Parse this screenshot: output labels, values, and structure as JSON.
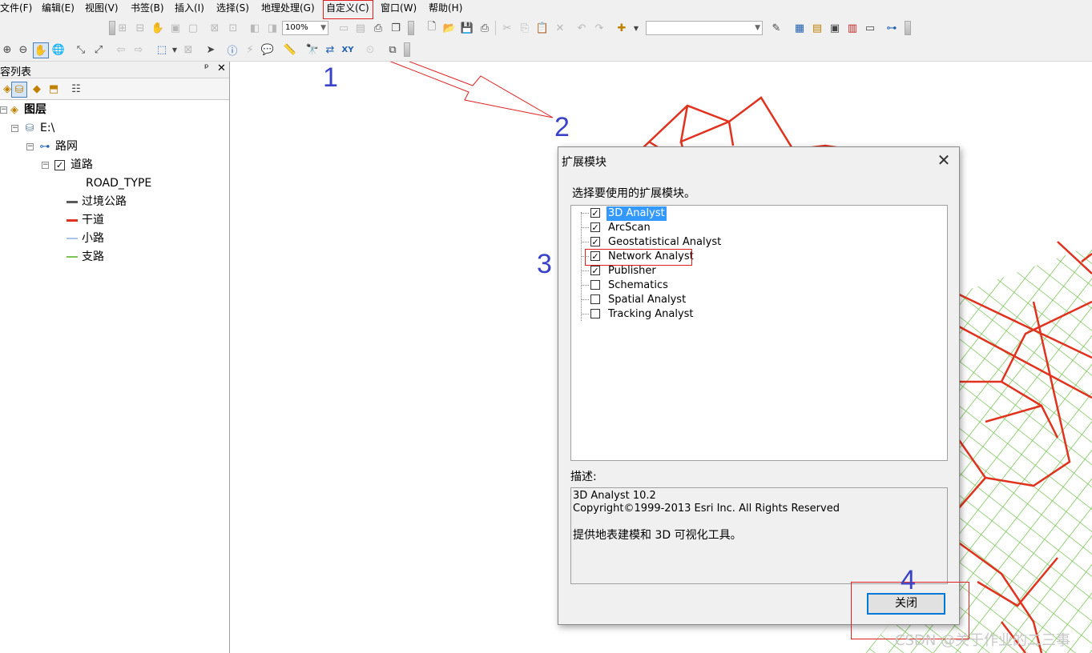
{
  "menu": [
    "文件(F)",
    "编辑(E)",
    "视图(V)",
    "书签(B)",
    "插入(I)",
    "选择(S)",
    "地理处理(G)",
    "自定义(C)",
    "窗口(W)",
    "帮助(H)"
  ],
  "toolbar": {
    "zoom_value": "100%",
    "scale_value": ""
  },
  "toc": {
    "title": "容列表",
    "pin_glyph": "ᵖ",
    "close_glyph": "✕",
    "root_label": "图层",
    "workspace_label": "E:\\",
    "dataset_label": "路网",
    "layer_label": "道路",
    "field_label": "ROAD_TYPE",
    "legend": [
      {
        "label": "过境公路",
        "color": "#5a5a5a"
      },
      {
        "label": "干道",
        "color": "#e0321e"
      },
      {
        "label": "小路",
        "color": "#a8c4e8"
      },
      {
        "label": "支路",
        "color": "#7cc45a"
      }
    ]
  },
  "dialog": {
    "title": "扩展模块",
    "prompt": "选择要使用的扩展模块。",
    "extensions": [
      {
        "name": "3D Analyst",
        "checked": true,
        "selected": true
      },
      {
        "name": "ArcScan",
        "checked": true,
        "selected": false
      },
      {
        "name": "Geostatistical Analyst",
        "checked": true,
        "selected": false
      },
      {
        "name": "Network Analyst",
        "checked": true,
        "selected": false
      },
      {
        "name": "Publisher",
        "checked": true,
        "selected": false
      },
      {
        "name": "Schematics",
        "checked": false,
        "selected": false
      },
      {
        "name": "Spatial Analyst",
        "checked": false,
        "selected": false
      },
      {
        "name": "Tracking Analyst",
        "checked": false,
        "selected": false
      }
    ],
    "description_label": "描述:",
    "description_lines": [
      "3D Analyst 10.2",
      "Copyright©1999-2013 Esri Inc. All Rights Reserved",
      "",
      "提供地表建模和 3D 可视化工具。"
    ],
    "close_button": "关闭"
  },
  "annotations": {
    "steps": [
      "1",
      "2",
      "3",
      "4"
    ],
    "color": "#3a43c7",
    "box_color": "#e02020"
  },
  "watermark": "CSDN @关于作业的二三事",
  "colors": {
    "road_main": "#e0321e",
    "road_branch": "#7cc45a",
    "selection": "#3399ff"
  }
}
